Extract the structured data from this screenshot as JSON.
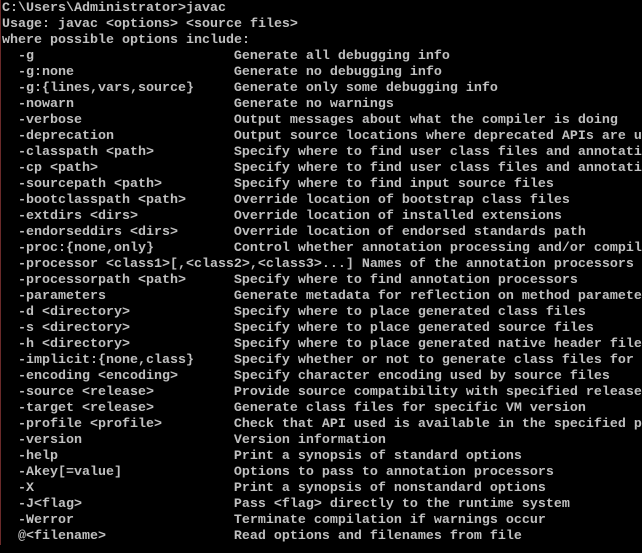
{
  "console": {
    "prompt_line": "C:\\Users\\Administrator>javac",
    "usage_line": "Usage: javac <options> <source files>",
    "intro_line": "where possible options include:",
    "options": [
      {
        "option": "-g",
        "description": "Generate all debugging info"
      },
      {
        "option": "-g:none",
        "description": "Generate no debugging info"
      },
      {
        "option": "-g:{lines,vars,source}",
        "description": "Generate only some debugging info"
      },
      {
        "option": "-nowarn",
        "description": "Generate no warnings"
      },
      {
        "option": "-verbose",
        "description": "Output messages about what the compiler is doing"
      },
      {
        "option": "-deprecation",
        "description": "Output source locations where deprecated APIs are u"
      },
      {
        "option": "-classpath <path>",
        "description": "Specify where to find user class files and annotati"
      },
      {
        "option": "-cp <path>",
        "description": "Specify where to find user class files and annotati"
      },
      {
        "option": "-sourcepath <path>",
        "description": "Specify where to find input source files"
      },
      {
        "option": "-bootclasspath <path>",
        "description": "Override location of bootstrap class files"
      },
      {
        "option": "-extdirs <dirs>",
        "description": "Override location of installed extensions"
      },
      {
        "option": "-endorseddirs <dirs>",
        "description": "Override location of endorsed standards path"
      },
      {
        "option": "-proc:{none,only}",
        "description": "Control whether annotation processing and/or compil"
      },
      {
        "option": "-processor <class1>[,<class2>,<class3>...]",
        "description": "Names of the annotation processors"
      },
      {
        "option": "-processorpath <path>",
        "description": "Specify where to find annotation processors"
      },
      {
        "option": "-parameters",
        "description": "Generate metadata for reflection on method paramete"
      },
      {
        "option": "-d <directory>",
        "description": "Specify where to place generated class files"
      },
      {
        "option": "-s <directory>",
        "description": "Specify where to place generated source files"
      },
      {
        "option": "-h <directory>",
        "description": "Specify where to place generated native header file"
      },
      {
        "option": "-implicit:{none,class}",
        "description": "Specify whether or not to generate class files for"
      },
      {
        "option": "-encoding <encoding>",
        "description": "Specify character encoding used by source files"
      },
      {
        "option": "-source <release>",
        "description": "Provide source compatibility with specified release"
      },
      {
        "option": "-target <release>",
        "description": "Generate class files for specific VM version"
      },
      {
        "option": "-profile <profile>",
        "description": "Check that API used is available in the specified p"
      },
      {
        "option": "-version",
        "description": "Version information"
      },
      {
        "option": "-help",
        "description": "Print a synopsis of standard options"
      },
      {
        "option": "-Akey[=value]",
        "description": "Options to pass to annotation processors"
      },
      {
        "option": "-X",
        "description": "Print a synopsis of nonstandard options"
      },
      {
        "option": "-J<flag>",
        "description": "Pass <flag> directly to the runtime system"
      },
      {
        "option": "-Werror",
        "description": "Terminate compilation if warnings occur"
      },
      {
        "option": "@<filename>",
        "description": "Read options and filenames from file"
      }
    ]
  },
  "colors": {
    "background": "#000000",
    "text": "#c0c0c0"
  }
}
